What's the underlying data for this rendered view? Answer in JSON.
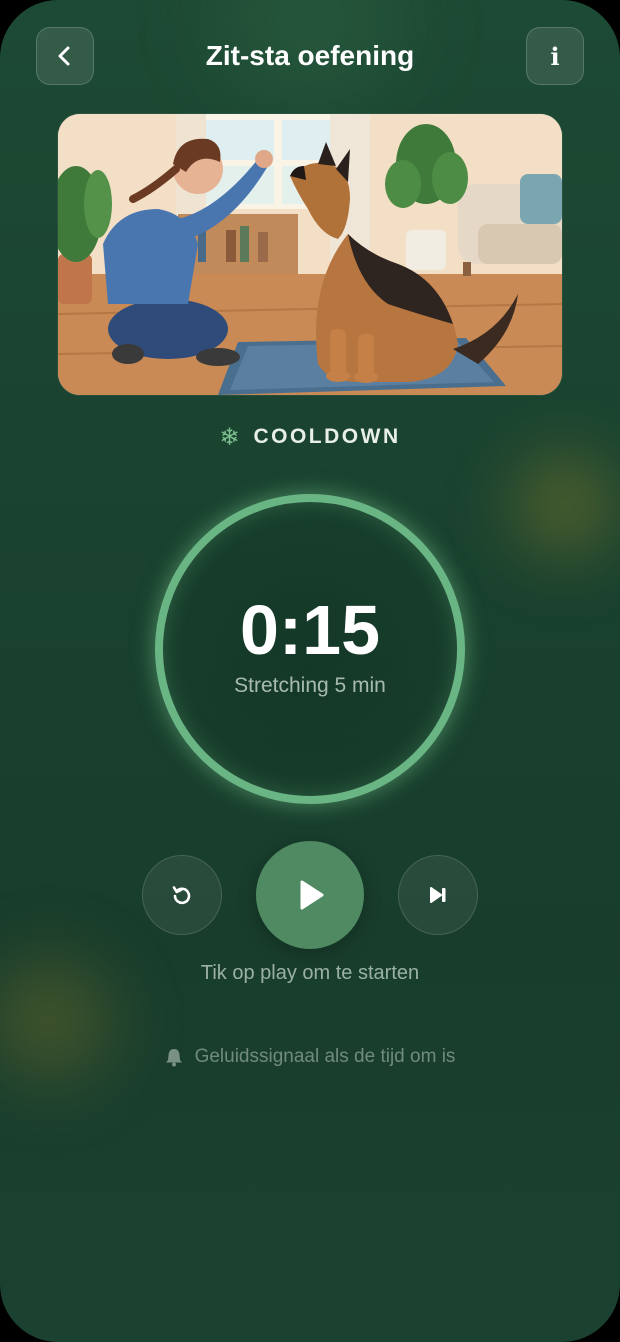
{
  "header": {
    "title": "Zit-sta oefening",
    "back_icon": "chevron-left-icon",
    "info_label": "i"
  },
  "illustration": {
    "description_icon": "dog-training-illustration"
  },
  "phase": {
    "icon": "snowflake-icon",
    "glyph": "❄",
    "label": "COOLDOWN"
  },
  "timer": {
    "time": "0:15",
    "subtitle": "Stretching 5 min",
    "progress": 1.0
  },
  "controls": {
    "reset_icon": "restart-icon",
    "play_icon": "play-icon",
    "skip_icon": "skip-next-icon",
    "hint": "Tik op play om te starten"
  },
  "sound": {
    "icon": "bell-icon",
    "label": "Geluidssignaal als de tijd om is"
  },
  "colors": {
    "background": "#1a4330",
    "accent": "#6ab584",
    "play_button": "#4f8a62"
  }
}
